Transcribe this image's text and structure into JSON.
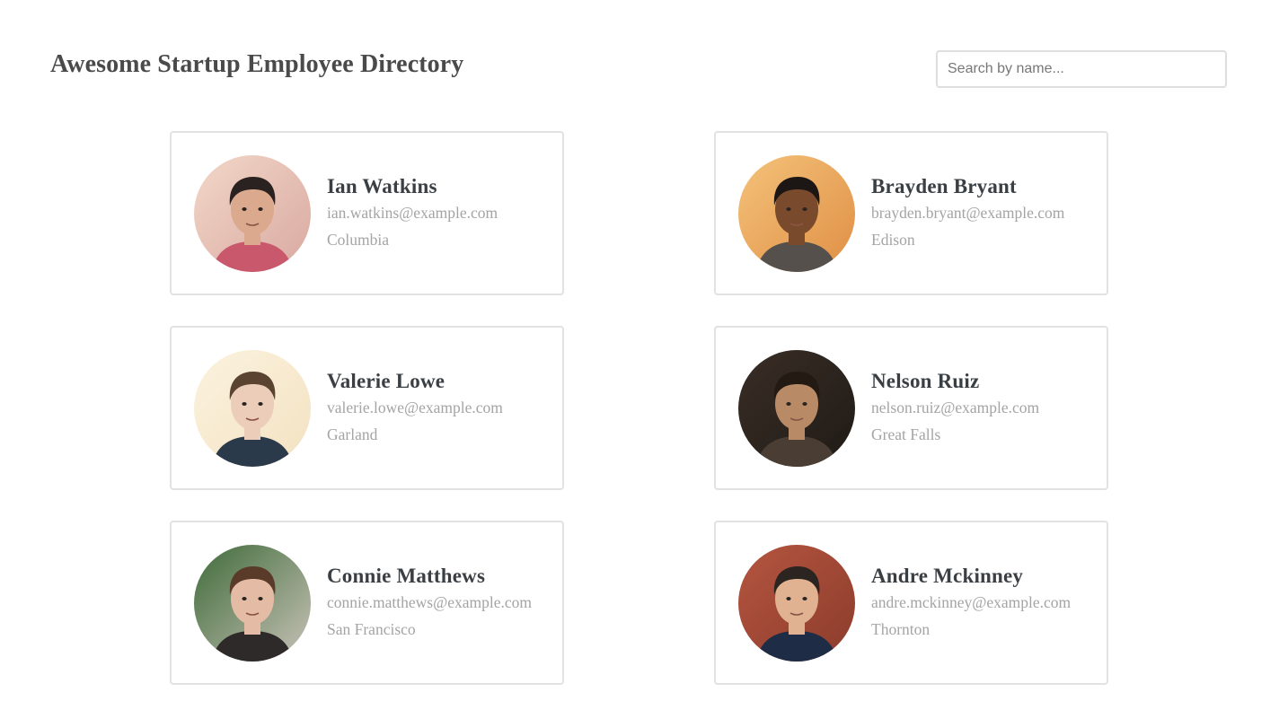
{
  "header": {
    "title": "Awesome Startup Employee Directory"
  },
  "search": {
    "placeholder": "Search by name..."
  },
  "employees": [
    {
      "name": "Ian Watkins",
      "email": "ian.watkins@example.com",
      "city": "Columbia",
      "avatar_icon": "person-photo-icon",
      "colors": {
        "bg1": "#f2d7c9",
        "bg2": "#d9a9a0",
        "skin": "#dba98e",
        "hair": "#2a2220",
        "shirt": "#c9586c"
      }
    },
    {
      "name": "Brayden Bryant",
      "email": "brayden.bryant@example.com",
      "city": "Edison",
      "avatar_icon": "person-photo-icon",
      "colors": {
        "bg1": "#f4c27a",
        "bg2": "#e08f45",
        "skin": "#7a4a2c",
        "hair": "#1c1714",
        "shirt": "#55504c"
      }
    },
    {
      "name": "Valerie Lowe",
      "email": "valerie.lowe@example.com",
      "city": "Garland",
      "avatar_icon": "person-photo-icon",
      "colors": {
        "bg1": "#fbf2de",
        "bg2": "#f3e2c2",
        "skin": "#eccdb9",
        "hair": "#5a4331",
        "shirt": "#2b3a4a"
      }
    },
    {
      "name": "Nelson Ruiz",
      "email": "nelson.ruiz@example.com",
      "city": "Great Falls",
      "avatar_icon": "person-photo-icon",
      "colors": {
        "bg1": "#3a2e26",
        "bg2": "#1f1a16",
        "skin": "#b98a66",
        "hair": "#241a14",
        "shirt": "#4a3e34"
      }
    },
    {
      "name": "Connie Matthews",
      "email": "connie.matthews@example.com",
      "city": "San Francisco",
      "avatar_icon": "person-photo-icon",
      "colors": {
        "bg1": "#3f6b3a",
        "bg2": "#c9c3b8",
        "skin": "#e4bca5",
        "hair": "#5a3a28",
        "shirt": "#2e2a2a"
      }
    },
    {
      "name": "Andre Mckinney",
      "email": "andre.mckinney@example.com",
      "city": "Thornton",
      "avatar_icon": "person-photo-icon",
      "colors": {
        "bg1": "#b4553f",
        "bg2": "#8c3c2c",
        "skin": "#e0b292",
        "hair": "#2c2420",
        "shirt": "#1e2c46"
      }
    }
  ]
}
